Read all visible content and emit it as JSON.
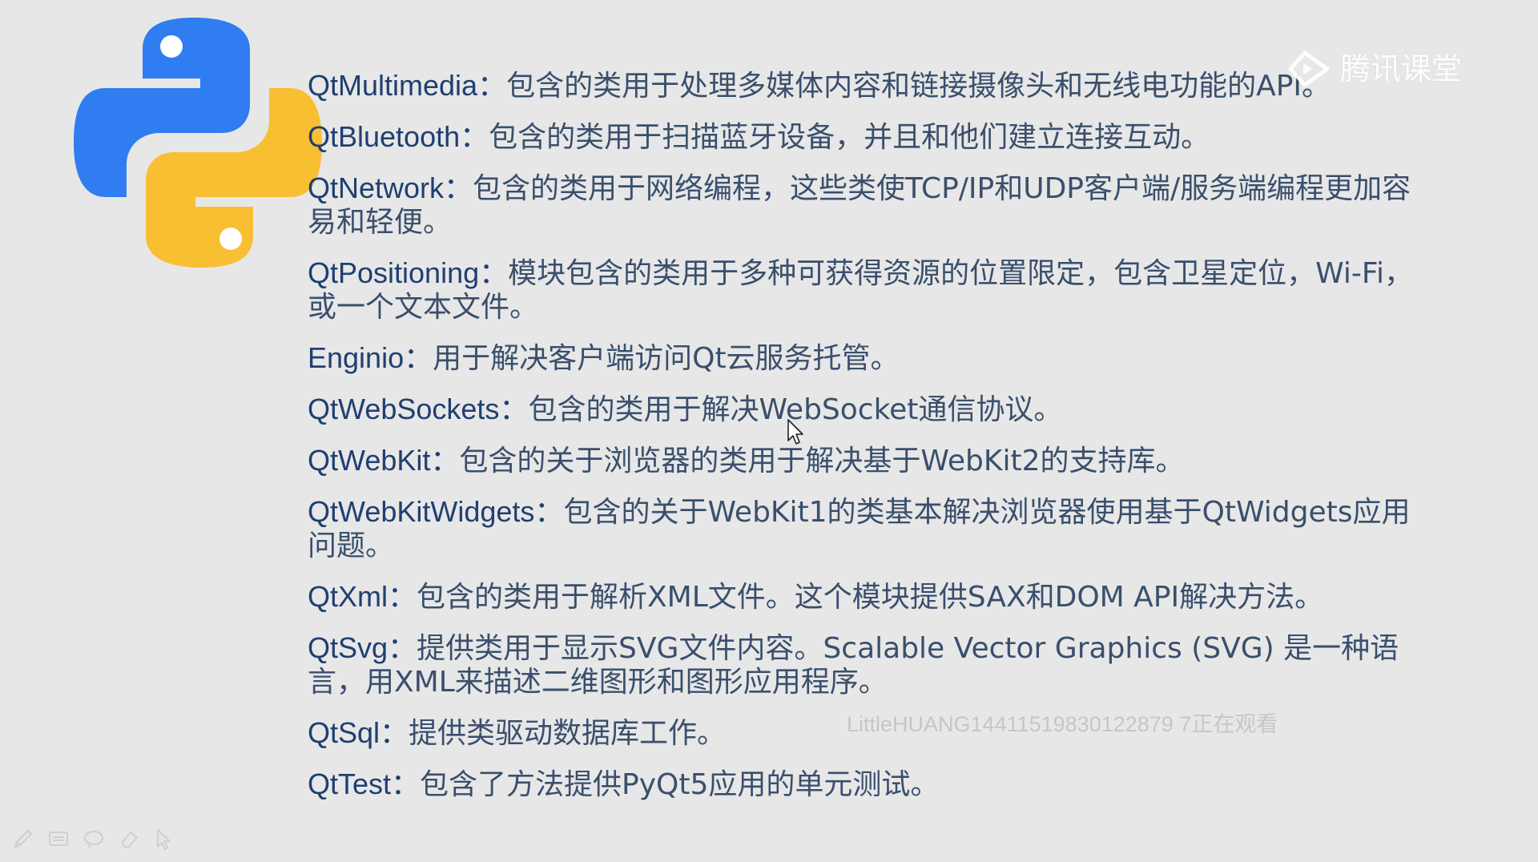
{
  "brand": {
    "watermark_text": "腾讯课堂",
    "logo_icon": "python-logo-icon",
    "colors": {
      "python_blue": "#2f7df0",
      "python_yellow": "#f8bf32",
      "text_term": "#1f3f70",
      "text_desc": "#3a4f6d",
      "background": "#e7e7e7"
    }
  },
  "slide": {
    "items": [
      {
        "term": "QtMultimedia：",
        "desc": "包含的类用于处理多媒体内容和链接摄像头和无线电功能的API。"
      },
      {
        "term": "QtBluetooth：",
        "desc": "包含的类用于扫描蓝牙设备，并且和他们建立连接互动。"
      },
      {
        "term": "QtNetwork：",
        "desc": "包含的类用于网络编程，这些类使TCP/IP和UDP客户端/服务端编程更加容易和轻便。"
      },
      {
        "term": "QtPositioning：",
        "desc": "模块包含的类用于多种可获得资源的位置限定，包含卫星定位，Wi-Fi，或一个文本文件。"
      },
      {
        "term": "Enginio：",
        "desc": "用于解决客户端访问Qt云服务托管。"
      },
      {
        "term": "QtWebSockets：",
        "desc": "包含的类用于解决WebSocket通信协议。"
      },
      {
        "term": "QtWebKit：",
        "desc": "包含的关于浏览器的类用于解决基于WebKit2的支持库。"
      },
      {
        "term": "QtWebKitWidgets：",
        "desc": "包含的关于WebKit1的类基本解决浏览器使用基于QtWidgets应用问题。"
      },
      {
        "term": "QtXml：",
        "desc": "包含的类用于解析XML文件。这个模块提供SAX和DOM API解决方法。"
      },
      {
        "term": "QtSvg：",
        "desc": "提供类用于显示SVG文件内容。Scalable Vector Graphics (SVG) 是一种语言，用XML来描述二维图形和图形应用程序。"
      },
      {
        "term": "QtSql：",
        "desc": "提供类驱动数据库工作。"
      },
      {
        "term": "QtTest：",
        "desc": "包含了方法提供PyQt5应用的单元测试。"
      }
    ]
  },
  "overlay": {
    "viewer_text": "LittleHUANG14411519830122879 7正在观看"
  },
  "toolbar": {
    "tools": [
      "pen-icon",
      "screen-icon",
      "lasso-icon",
      "eraser-icon",
      "pointer-icon"
    ]
  }
}
